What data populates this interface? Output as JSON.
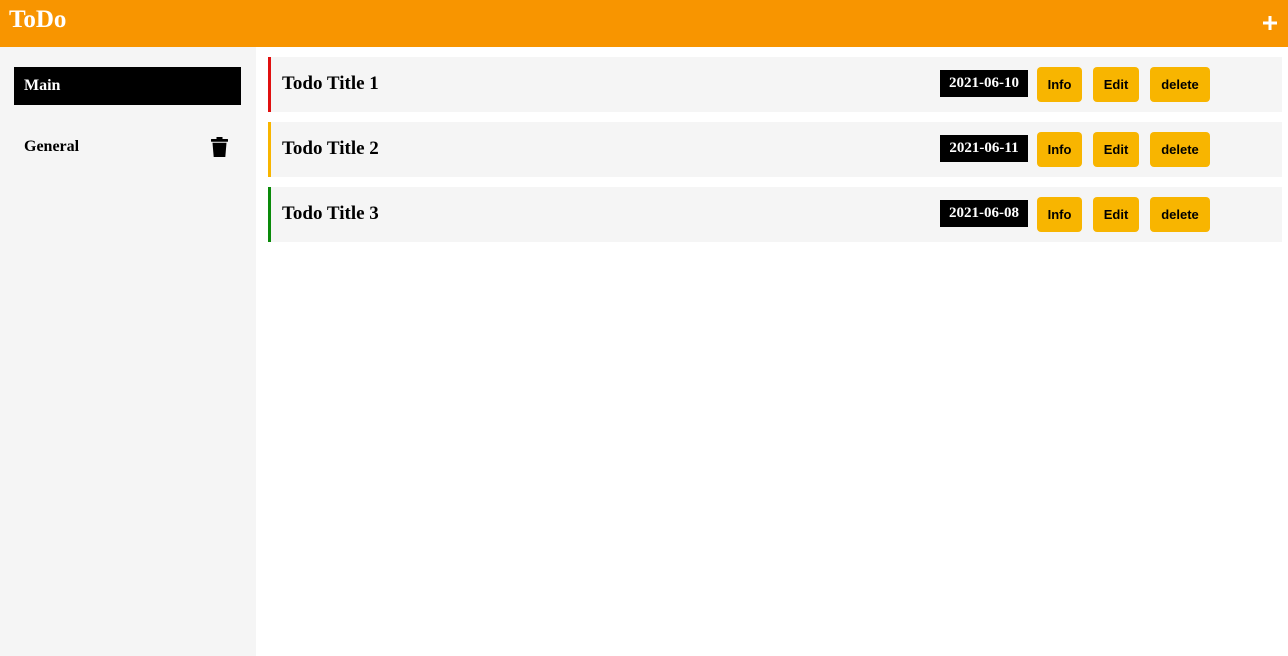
{
  "header": {
    "title": "ToDo",
    "add_icon": "plus-icon",
    "background": "#f89500"
  },
  "sidebar": {
    "items": [
      {
        "label": "Main",
        "active": true
      },
      {
        "label": "General",
        "active": false,
        "icon": "trash-icon"
      }
    ]
  },
  "todos": [
    {
      "title": "Todo Title 1",
      "date": "2021-06-10",
      "priority_color": "#e01010",
      "info_label": "Info",
      "edit_label": "Edit",
      "delete_label": "delete"
    },
    {
      "title": "Todo Title 2",
      "date": "2021-06-11",
      "priority_color": "#f8b500",
      "info_label": "Info",
      "edit_label": "Edit",
      "delete_label": "delete"
    },
    {
      "title": "Todo Title 3",
      "date": "2021-06-08",
      "priority_color": "#0a8a0a",
      "info_label": "Info",
      "edit_label": "Edit",
      "delete_label": "delete"
    }
  ],
  "colors": {
    "accent": "#f89500",
    "button": "#f8b500",
    "sidebar_bg": "#f5f5f5",
    "row_bg": "#f5f5f5"
  }
}
